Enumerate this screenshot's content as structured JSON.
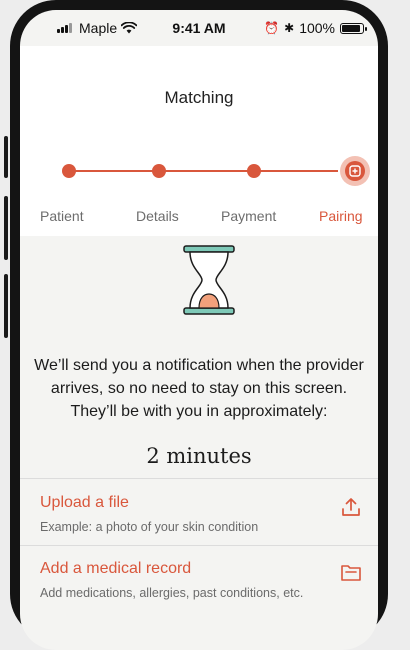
{
  "status_bar": {
    "carrier": "Maple",
    "time": "9:41 AM",
    "battery": "100%"
  },
  "header": {
    "title": "Matching"
  },
  "stepper": {
    "steps": [
      {
        "label": "Patient",
        "state": "complete"
      },
      {
        "label": "Details",
        "state": "complete"
      },
      {
        "label": "Payment",
        "state": "complete"
      },
      {
        "label": "Pairing",
        "state": "active"
      }
    ]
  },
  "main": {
    "notice": "We’ll send you a notification when the provider arrives, so no need to stay on this screen. They’ll be with you in approximately:",
    "eta": "2 minutes"
  },
  "actions": [
    {
      "title": "Upload a file",
      "subtitle": "Example: a photo of your skin condition",
      "icon": "upload-icon"
    },
    {
      "title": "Add a medical record",
      "subtitle": "Add medications, allergies, past conditions, etc.",
      "icon": "folder-icon"
    }
  ],
  "colors": {
    "accent": "#d9573c",
    "accent_light": "#f3c1b4",
    "hourglass_teal": "#7ec9b8",
    "sand": "#f2a17c"
  }
}
